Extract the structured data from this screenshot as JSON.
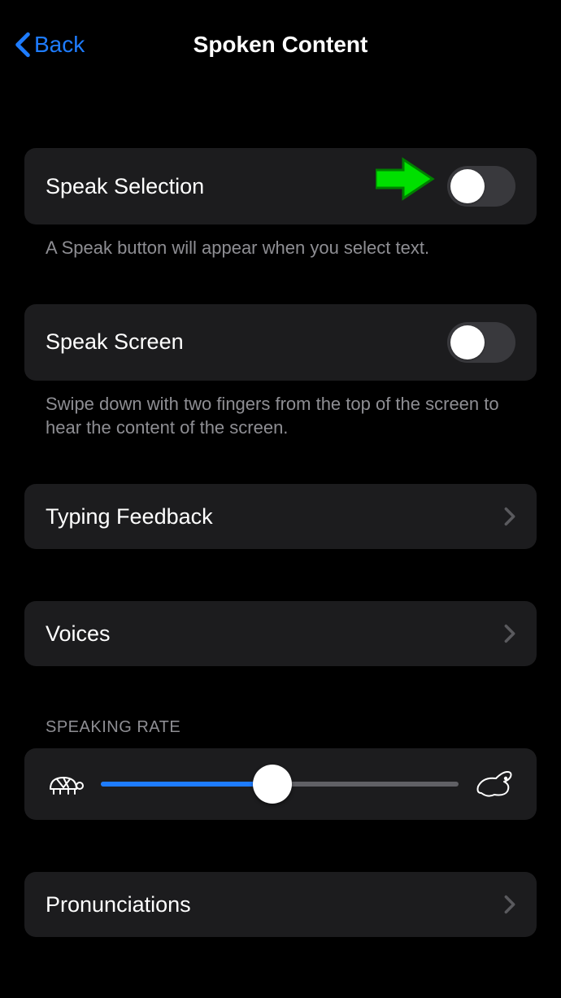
{
  "nav": {
    "back_label": "Back",
    "title": "Spoken Content"
  },
  "rows": {
    "speak_selection": {
      "label": "Speak Selection",
      "footer": "A Speak button will appear when you select text.",
      "toggle_on": false
    },
    "speak_screen": {
      "label": "Speak Screen",
      "footer": "Swipe down with two fingers from the top of the screen to hear the content of the screen.",
      "toggle_on": false
    },
    "typing_feedback": {
      "label": "Typing Feedback"
    },
    "voices": {
      "label": "Voices"
    },
    "speaking_rate_header": "SPEAKING RATE",
    "speaking_rate_value_percent": 48,
    "pronunciations": {
      "label": "Pronunciations"
    }
  }
}
